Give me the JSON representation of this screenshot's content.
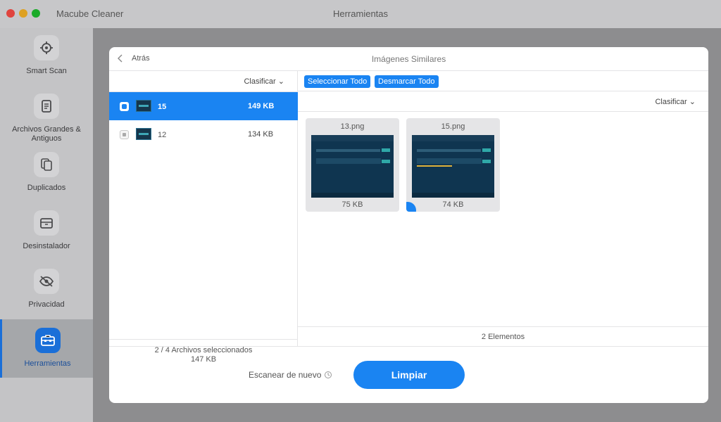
{
  "window": {
    "app_name": "Macube Cleaner",
    "title": "Herramientas"
  },
  "sidebar": {
    "items": [
      {
        "label": "Smart Scan",
        "icon": "crosshair-icon"
      },
      {
        "label": "Archivos Grandes & Antiguos",
        "icon": "document-icon"
      },
      {
        "label": "Duplicados",
        "icon": "copy-icon"
      },
      {
        "label": "Desinstalador",
        "icon": "box-icon"
      },
      {
        "label": "Privacidad",
        "icon": "eye-off-icon"
      },
      {
        "label": "Herramientas",
        "icon": "toolbox-icon",
        "active": true
      }
    ]
  },
  "modal": {
    "back_label": "Atrás",
    "title": "Imágenes Similares",
    "left": {
      "sort_label": "Clasificar",
      "groups": [
        {
          "name": "15",
          "size": "149 KB",
          "selected": true
        },
        {
          "name": "12",
          "size": "134 KB",
          "selected": false
        }
      ],
      "footer_selected": "2 / 4 Archivos seleccionados",
      "footer_size": "147 KB"
    },
    "right": {
      "select_all": "Seleccionar Todo",
      "deselect_all": "Desmarcar Todo",
      "sort_label": "Clasificar",
      "images": [
        {
          "name": "13.png",
          "size": "75 KB"
        },
        {
          "name": "15.png",
          "size": "74 KB"
        }
      ],
      "footer": "2 Elementos"
    },
    "rescan_label": "Escanear de nuevo",
    "clean_label": "Limpiar"
  },
  "colors": {
    "accent": "#1a84f2",
    "sidebar_bg": "#c4c4c6",
    "dim_bg": "#8d8d8f"
  }
}
